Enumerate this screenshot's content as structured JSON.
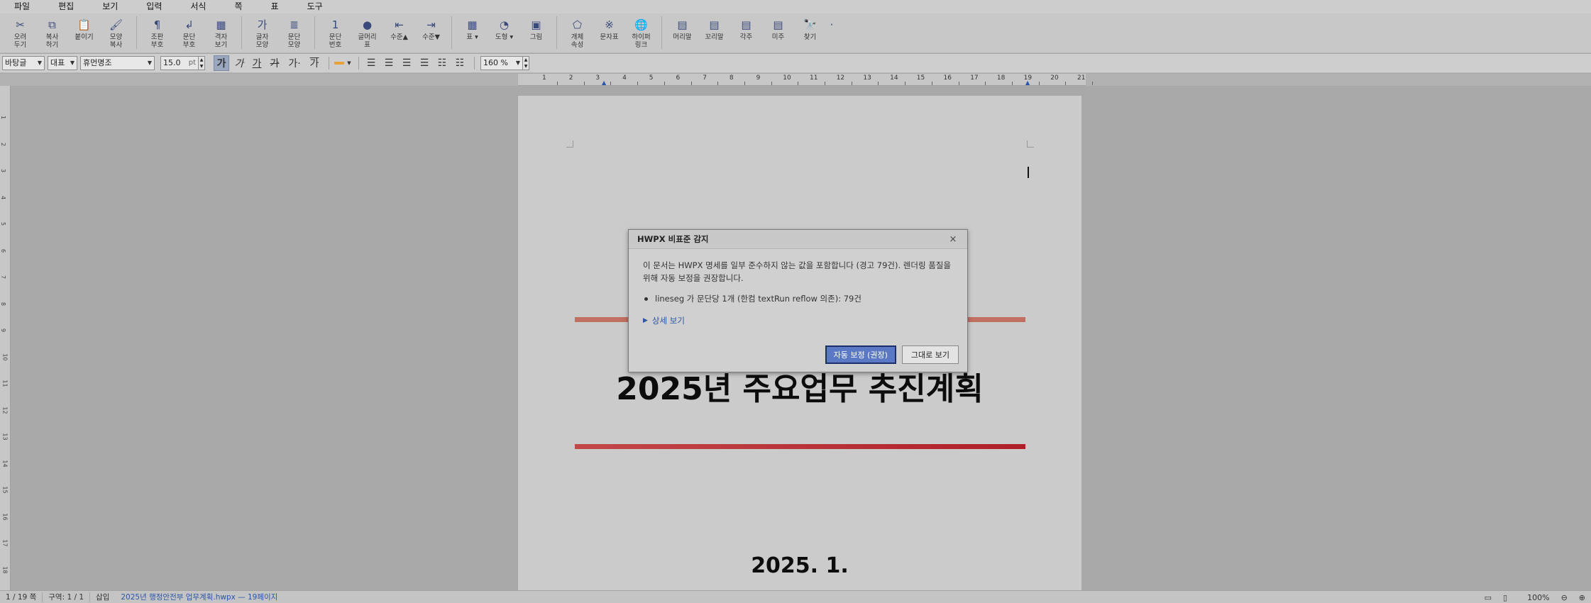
{
  "menu": [
    "파일",
    "편집",
    "보기",
    "입력",
    "서식",
    "쪽",
    "표",
    "도구"
  ],
  "toolbar": {
    "group1": [
      {
        "label": "오려\n두기",
        "icon": "scissors-icon",
        "glyph": "✂"
      },
      {
        "label": "복사\n하기",
        "icon": "copy-icon",
        "glyph": "⧉"
      },
      {
        "label": "붙이기",
        "icon": "paste-icon",
        "glyph": "📋"
      },
      {
        "label": "모양\n복사",
        "icon": "format-painter-icon",
        "glyph": "🖌"
      }
    ],
    "group2": [
      {
        "label": "조판\n부호",
        "icon": "pilcrow-icon",
        "glyph": "¶"
      },
      {
        "label": "문단\n부호",
        "icon": "paragraph-mark-icon",
        "glyph": "↲"
      },
      {
        "label": "격자\n보기",
        "icon": "grid-icon",
        "glyph": "▦"
      }
    ],
    "group3": [
      {
        "label": "글자\n모양",
        "icon": "char-shape-icon",
        "glyph": "가"
      },
      {
        "label": "문단\n모양",
        "icon": "para-shape-icon",
        "glyph": "≣"
      }
    ],
    "group4": [
      {
        "label": "문단\n번호",
        "icon": "numbering-icon",
        "glyph": "1"
      },
      {
        "label": "글머리\n표",
        "icon": "bullet-icon",
        "glyph": "●"
      },
      {
        "label": "수준▲",
        "icon": "outdent-icon",
        "glyph": "⇤"
      },
      {
        "label": "수준▼",
        "icon": "indent-icon",
        "glyph": "⇥"
      }
    ],
    "group5": [
      {
        "label": "표 ▾",
        "icon": "table-icon",
        "glyph": "▦"
      },
      {
        "label": "도형 ▾",
        "icon": "shapes-icon",
        "glyph": "◔"
      },
      {
        "label": "그림",
        "icon": "picture-icon",
        "glyph": "▣"
      }
    ],
    "group6": [
      {
        "label": "개체\n속성",
        "icon": "object-props-icon",
        "glyph": "⬠"
      },
      {
        "label": "문자표",
        "icon": "symbol-icon",
        "glyph": "※"
      },
      {
        "label": "하이퍼\n링크",
        "icon": "hyperlink-icon",
        "glyph": "🌐"
      }
    ],
    "group7": [
      {
        "label": "머리말",
        "icon": "header-icon",
        "glyph": "▤"
      },
      {
        "label": "꼬리말",
        "icon": "footer-icon",
        "glyph": "▤"
      },
      {
        "label": "각주",
        "icon": "footnote-icon",
        "glyph": "▤"
      },
      {
        "label": "미주",
        "icon": "endnote-icon",
        "glyph": "▤"
      },
      {
        "label": "찾기",
        "icon": "find-icon",
        "glyph": "🔭"
      }
    ],
    "more": "·"
  },
  "format": {
    "style": "바탕글",
    "lang": "대표",
    "font": "휴먼명조",
    "size": "15.0",
    "unit": "pt",
    "char_buttons": [
      "가",
      "가",
      "가",
      "가",
      "가·",
      "가"
    ],
    "zoom": "160 %"
  },
  "ruler": [
    "1",
    "2",
    "3",
    "4",
    "5",
    "6",
    "7",
    "8",
    "9",
    "10",
    "11",
    "12",
    "13",
    "14",
    "15",
    "16",
    "17",
    "18",
    "19",
    "20",
    "21"
  ],
  "vruler": [
    "1",
    "2",
    "3",
    "4",
    "5",
    "6",
    "7",
    "8",
    "9",
    "10",
    "11",
    "12",
    "13",
    "14",
    "15",
    "16",
    "17",
    "18"
  ],
  "document": {
    "title": "2025년 주요업무 추진계획",
    "date": "2025. 1."
  },
  "dialog": {
    "title": "HWPX 비표준 감지",
    "close": "×",
    "message": "이 문서는 HWPX 명세를 일부 준수하지 않는 값을 포함합니다 (경고 79건). 렌더링 품질을 위해 자동 보정을 권장합니다.",
    "items": [
      "lineseg 가 문단당 1개 (한컴 textRun reflow 의존): 79건"
    ],
    "details": "상세 보기",
    "primary_button": "자동 보정 (권장)",
    "secondary_button": "그대로 보기"
  },
  "status": {
    "page": "1 / 19 쪽",
    "section": "구역: 1 / 1",
    "mode": "삽입",
    "file": "2025년 행정안전부 업무계획.hwpx — 19페이지",
    "zoom": "100%"
  },
  "colors": {
    "accent": "#5a78c4",
    "line_top": "#c07060",
    "line_bottom": "#b8232b"
  }
}
